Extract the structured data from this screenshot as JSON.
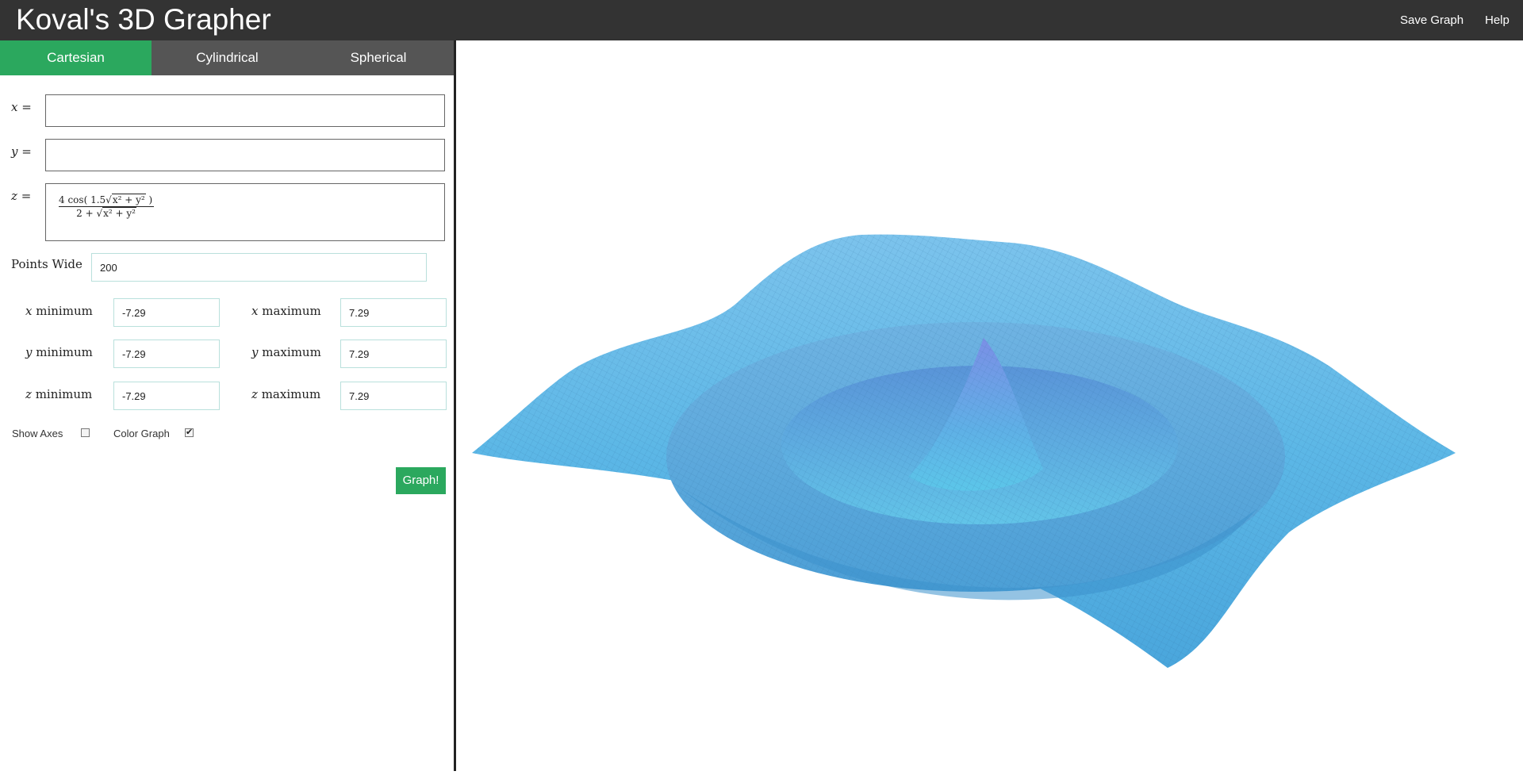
{
  "header": {
    "title": "Koval's 3D Grapher",
    "save_label": "Save Graph",
    "help_label": "Help",
    "bg_color": "#333333"
  },
  "tabs": [
    {
      "label": "Cartesian",
      "active": true
    },
    {
      "label": "Cylindrical",
      "active": false
    },
    {
      "label": "Spherical",
      "active": false
    }
  ],
  "equations": {
    "x": {
      "var": "x",
      "eq": "=",
      "value": ""
    },
    "y": {
      "var": "y",
      "eq": "=",
      "value": ""
    },
    "z": {
      "var": "z",
      "eq": "=",
      "num_a": "4 cos",
      "num_b": "1.5",
      "num_rad": "x² + y²",
      "den_a": "2 + ",
      "den_rad": "x² + y²"
    }
  },
  "points_wide": {
    "label": "Points Wide",
    "value": "200"
  },
  "ranges": {
    "x_min": {
      "var": "x",
      "word": "minimum",
      "value": "-7.29"
    },
    "x_max": {
      "var": "x",
      "word": "maximum",
      "value": "7.29"
    },
    "y_min": {
      "var": "y",
      "word": "minimum",
      "value": "-7.29"
    },
    "y_max": {
      "var": "y",
      "word": "maximum",
      "value": "7.29"
    },
    "z_min": {
      "var": "z",
      "word": "minimum",
      "value": "-7.29"
    },
    "z_max": {
      "var": "z",
      "word": "maximum",
      "value": "7.29"
    }
  },
  "options": {
    "show_axes_label": "Show Axes",
    "show_axes_checked": false,
    "color_graph_label": "Color Graph",
    "color_graph_checked": true,
    "graph_button": "Graph!"
  },
  "colors": {
    "accent": "#2ba85e",
    "surface": "#5cb7e6",
    "surface_mesh": "#3f8fc4"
  }
}
